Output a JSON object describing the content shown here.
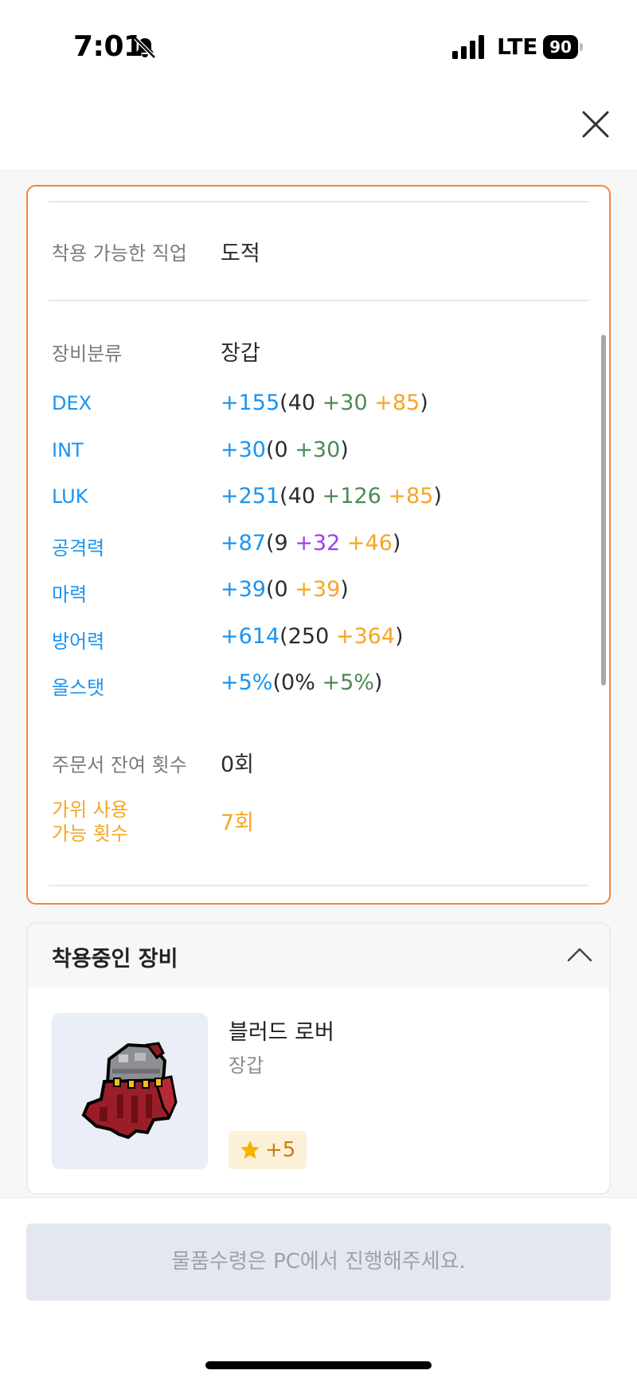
{
  "status_bar": {
    "time": "7:01",
    "network": "LTE",
    "battery": "90"
  },
  "detail": {
    "job_label": "착용 가능한 직업",
    "job_value": "도적",
    "category_label": "장비분류",
    "category_value": "장갑",
    "stats": [
      {
        "label": "DEX",
        "total": "+155",
        "base": "40",
        "bonus": [
          {
            "text": "+30",
            "color": "green"
          },
          {
            "text": "+85",
            "color": "orange"
          }
        ]
      },
      {
        "label": "INT",
        "total": "+30",
        "base": "0",
        "bonus": [
          {
            "text": "+30",
            "color": "green"
          }
        ]
      },
      {
        "label": "LUK",
        "total": "+251",
        "base": "40",
        "bonus": [
          {
            "text": "+126",
            "color": "green"
          },
          {
            "text": "+85",
            "color": "orange"
          }
        ]
      },
      {
        "label": "공격력",
        "total": "+87",
        "base": "9",
        "bonus": [
          {
            "text": "+32",
            "color": "purple"
          },
          {
            "text": "+46",
            "color": "orange"
          }
        ]
      },
      {
        "label": "마력",
        "total": "+39",
        "base": "0",
        "bonus": [
          {
            "text": "+39",
            "color": "orange"
          }
        ]
      },
      {
        "label": "방어력",
        "total": "+614",
        "base": "250",
        "bonus": [
          {
            "text": "+364",
            "color": "orange"
          }
        ]
      },
      {
        "label": "올스탯",
        "total": "+5%",
        "base": "0%",
        "bonus": [
          {
            "text": "+5%",
            "color": "green"
          }
        ]
      }
    ],
    "scroll_label": "주문서 잔여 횟수",
    "scroll_value": "0회",
    "scissors_label_line1": "가위 사용",
    "scissors_label_line2": "가능 횟수",
    "scissors_value": "7회"
  },
  "equipped": {
    "title": "착용중인 장비",
    "item_name": "블러드 로버",
    "item_type": "장갑",
    "star_force": "+5"
  },
  "bottom": {
    "notice": "물품수령은 PC에서 진행해주세요."
  },
  "colors": {
    "accent_border": "#f5843b",
    "stat_blue": "#1a94f0",
    "bonus_green": "#4d8a55",
    "bonus_orange": "#f5a623",
    "bonus_purple": "#9b3ff2"
  },
  "icons": [
    "bell-slash-icon",
    "signal-icon",
    "battery-icon",
    "close-icon",
    "chevron-up-icon",
    "star-icon"
  ]
}
